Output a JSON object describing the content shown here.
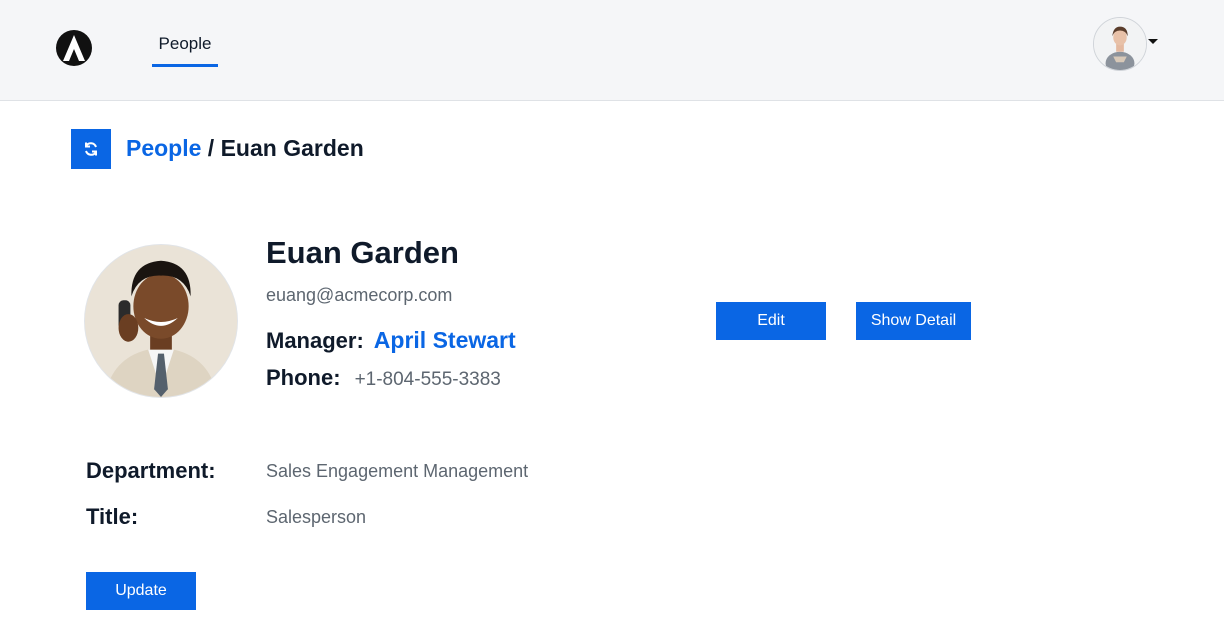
{
  "header": {
    "logo_icon": "arrow-triangle-logo",
    "nav": {
      "people_label": "People"
    },
    "user_menu": {
      "avatar": "user-avatar",
      "caret_icon": "caret-down-icon"
    }
  },
  "breadcrumb": {
    "refresh_icon": "refresh-icon",
    "parent": "People",
    "separator": " / ",
    "current": "Euan Garden"
  },
  "profile": {
    "name": "Euan Garden",
    "email": "euang@acmecorp.com",
    "manager_label": "Manager:",
    "manager_name": "April Stewart",
    "phone_label": "Phone:",
    "phone": "+1-804-555-3383"
  },
  "actions": {
    "edit_label": "Edit",
    "show_detail_label": "Show Detail",
    "update_label": "Update"
  },
  "details": {
    "department_label": "Department:",
    "department": "Sales Engagement Management",
    "title_label": "Title:",
    "title": "Salesperson"
  },
  "colors": {
    "accent": "#0a66e4",
    "header_bg": "#f5f6f8",
    "text_dark": "#0f1a2a",
    "text_muted": "#5d6670"
  }
}
